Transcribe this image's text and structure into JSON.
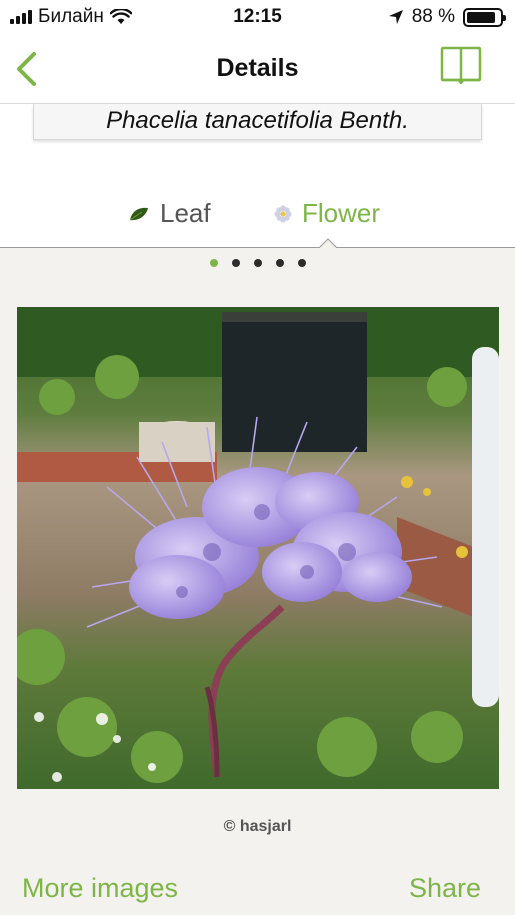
{
  "status_bar": {
    "carrier": "Билайн",
    "time": "12:15",
    "battery_percent": "88 %",
    "battery_level": 0.88
  },
  "nav": {
    "title": "Details",
    "back_icon": "chevron-left-icon",
    "book_icon": "book-icon",
    "accent_color": "#7db547"
  },
  "plant": {
    "latin_name": "Phacelia tanacetifolia Benth."
  },
  "tabs": [
    {
      "label": "Leaf",
      "icon": "leaf-icon",
      "selected": false
    },
    {
      "label": "Flower",
      "icon": "flower-icon",
      "selected": true
    }
  ],
  "carousel": {
    "page_count": 5,
    "current_page": 1
  },
  "photo": {
    "credit": "© hasjarl"
  },
  "footer": {
    "more_images_label": "More images",
    "share_label": "Share"
  }
}
